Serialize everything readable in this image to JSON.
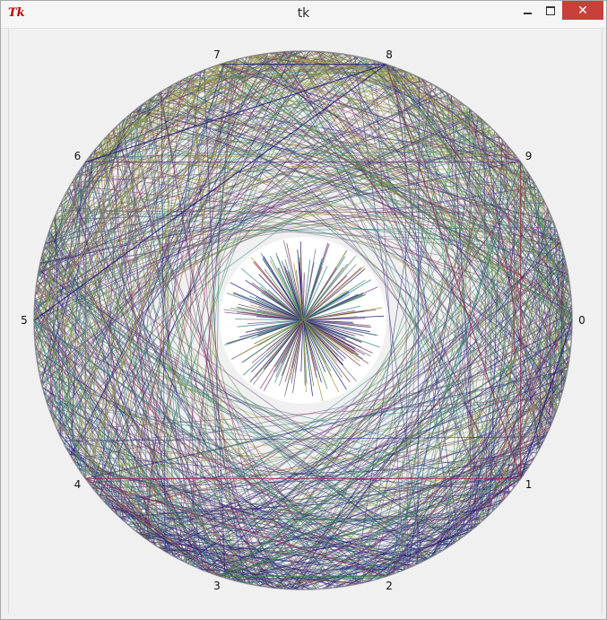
{
  "window": {
    "title": "tk",
    "icon": "tk-feather-icon",
    "buttons": {
      "minimize": "minimize-icon",
      "maximize": "maximize-icon",
      "close": "close-icon"
    }
  },
  "canvas": {
    "point_labels": [
      "0",
      "1",
      "2",
      "3",
      "4",
      "5",
      "6",
      "7",
      "8",
      "9"
    ],
    "colors": {
      "background": "#f0f0f0",
      "inner_disc": "#ffffff",
      "olive": "#9c9a3c",
      "navy": "#17177a",
      "purple": "#6d3f86",
      "green": "#3f8a4a",
      "maroon": "#8a2f55",
      "teal": "#2f7f7f",
      "grey": "#6d6d7d"
    }
  }
}
